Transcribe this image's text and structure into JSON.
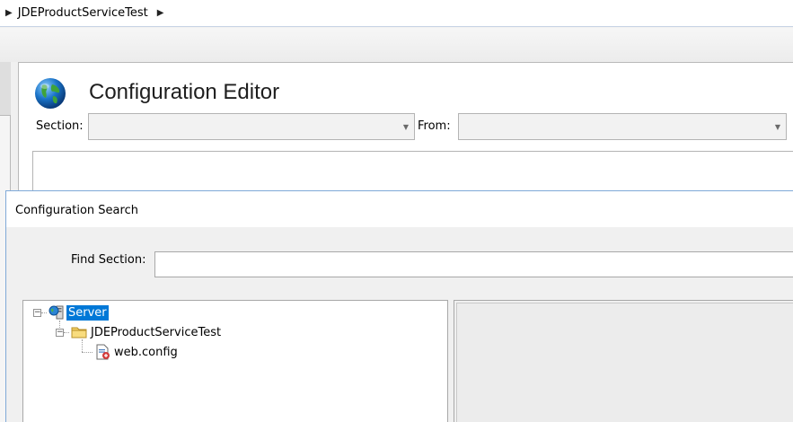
{
  "breadcrumb": {
    "items": [
      "JDEProductServiceTest"
    ]
  },
  "editor": {
    "title": "Configuration Editor",
    "section_label": "Section:",
    "section_value": "",
    "from_label": "From:",
    "from_value": ""
  },
  "search_dialog": {
    "title": "Configuration Search",
    "find_label": "Find Section:",
    "find_value": "",
    "tree": {
      "root": "Server",
      "site": "JDEProductServiceTest",
      "file": "web.config"
    }
  },
  "icons": {
    "globe": "globe-icon",
    "server": "server-icon",
    "folder": "folder-icon",
    "config_file": "config-file-icon"
  },
  "colors": {
    "selection": "#0078d7",
    "dialog_border": "#7fa9d8"
  }
}
